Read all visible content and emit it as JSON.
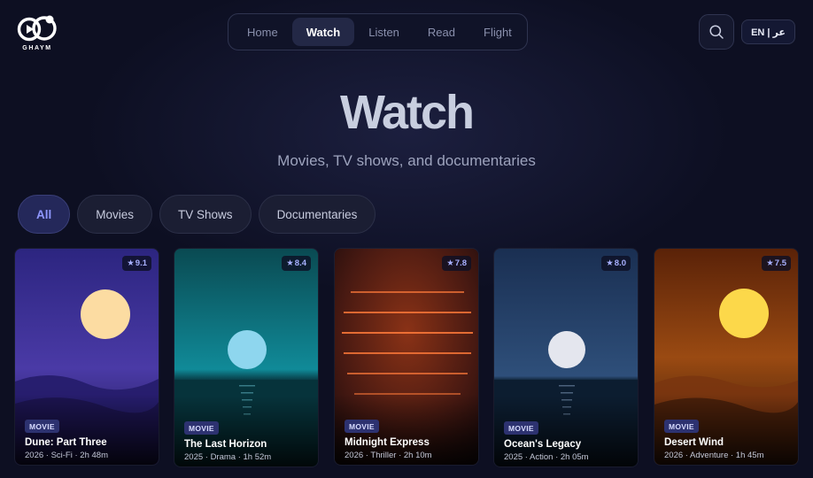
{
  "brand": {
    "name": "GHAYM"
  },
  "nav": {
    "items": [
      {
        "label": "Home",
        "active": false
      },
      {
        "label": "Watch",
        "active": true
      },
      {
        "label": "Listen",
        "active": false
      },
      {
        "label": "Read",
        "active": false
      },
      {
        "label": "Flight",
        "active": false
      }
    ]
  },
  "header": {
    "search_icon": "search-icon",
    "language_label": "EN | عر"
  },
  "hero": {
    "title": "Watch",
    "subtitle": "Movies, TV shows, and documentaries"
  },
  "filters": [
    {
      "label": "All",
      "active": true
    },
    {
      "label": "Movies",
      "active": false
    },
    {
      "label": "TV Shows",
      "active": false
    },
    {
      "label": "Documentaries",
      "active": false
    }
  ],
  "cards": [
    {
      "title": "Dune: Part Three",
      "type": "MOVIE",
      "rating": "9.1",
      "meta": "2026 · Sci-Fi · 2h 48m"
    },
    {
      "title": "The Last Horizon",
      "type": "MOVIE",
      "rating": "8.4",
      "meta": "2025 · Drama · 1h 52m"
    },
    {
      "title": "Midnight Express",
      "type": "MOVIE",
      "rating": "7.8",
      "meta": "2026 · Thriller · 2h 10m"
    },
    {
      "title": "Ocean's Legacy",
      "type": "MOVIE",
      "rating": "8.0",
      "meta": "2025 · Action · 2h 05m"
    },
    {
      "title": "Desert Wind",
      "type": "MOVIE",
      "rating": "7.5",
      "meta": "2026 · Adventure · 1h 45m"
    }
  ],
  "colors": {
    "background": "#0d0f22",
    "accent": "#8f97ff",
    "badge": "#2d3270"
  }
}
